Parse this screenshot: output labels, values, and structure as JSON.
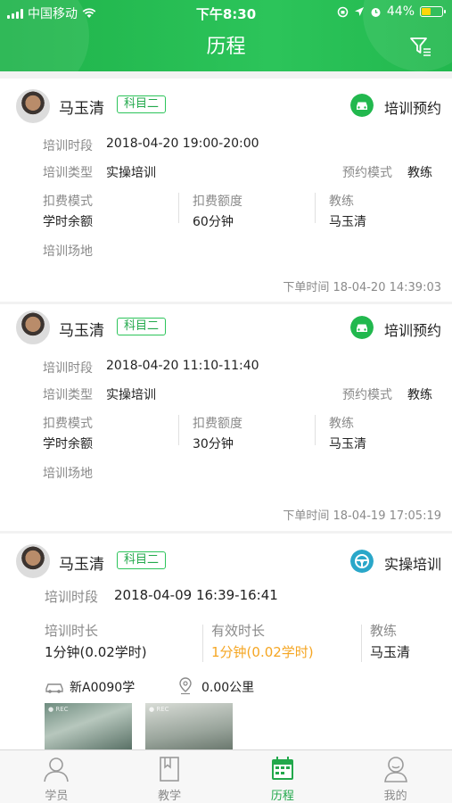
{
  "status_bar": {
    "carrier": "中国移动",
    "time": "下午8:30",
    "battery": "44%",
    "battery_level": 0.44
  },
  "nav": {
    "title": "历程"
  },
  "cards": [
    {
      "name": "马玉清",
      "tag": "科目二",
      "type_label": "培训预约",
      "period_label": "培训时段",
      "period": "2018-04-20 19:00-20:00",
      "train_type_label": "培训类型",
      "train_type": "实操培训",
      "mode_label": "预约模式",
      "mode": "教练",
      "fee_mode_label": "扣费模式",
      "fee_mode": "学时余额",
      "fee_amount_label": "扣费额度",
      "fee_amount": "60分钟",
      "coach_label": "教练",
      "coach": "马玉清",
      "venue_label": "培训场地",
      "order_time": "下单时间 18-04-20 14:39:03"
    },
    {
      "name": "马玉清",
      "tag": "科目二",
      "type_label": "培训预约",
      "period_label": "培训时段",
      "period": "2018-04-20 11:10-11:40",
      "train_type_label": "培训类型",
      "train_type": "实操培训",
      "mode_label": "预约模式",
      "mode": "教练",
      "fee_mode_label": "扣费模式",
      "fee_mode": "学时余额",
      "fee_amount_label": "扣费额度",
      "fee_amount": "30分钟",
      "coach_label": "教练",
      "coach": "马玉清",
      "venue_label": "培训场地",
      "order_time": "下单时间 18-04-19 17:05:19"
    },
    {
      "name": "马玉清",
      "tag": "科目二",
      "type_label": "实操培训",
      "period_label": "培训时段",
      "period": "2018-04-09 16:39-16:41",
      "duration_label": "培训时长",
      "duration": "1分钟(0.02学时)",
      "valid_label": "有效时长",
      "valid": "1分钟(0.02学时)",
      "coach_label": "教练",
      "coach": "马玉清",
      "car": "新A0090学",
      "distance": "0.00公里"
    }
  ],
  "tabs": [
    {
      "label": "学员",
      "icon": "student-icon"
    },
    {
      "label": "教学",
      "icon": "teaching-icon"
    },
    {
      "label": "历程",
      "icon": "calendar-icon",
      "active": true
    },
    {
      "label": "我的",
      "icon": "profile-icon"
    }
  ],
  "colors": {
    "brand": "#2cc45a",
    "accent_orange": "#f5a623",
    "teal": "#2aa7c9"
  }
}
